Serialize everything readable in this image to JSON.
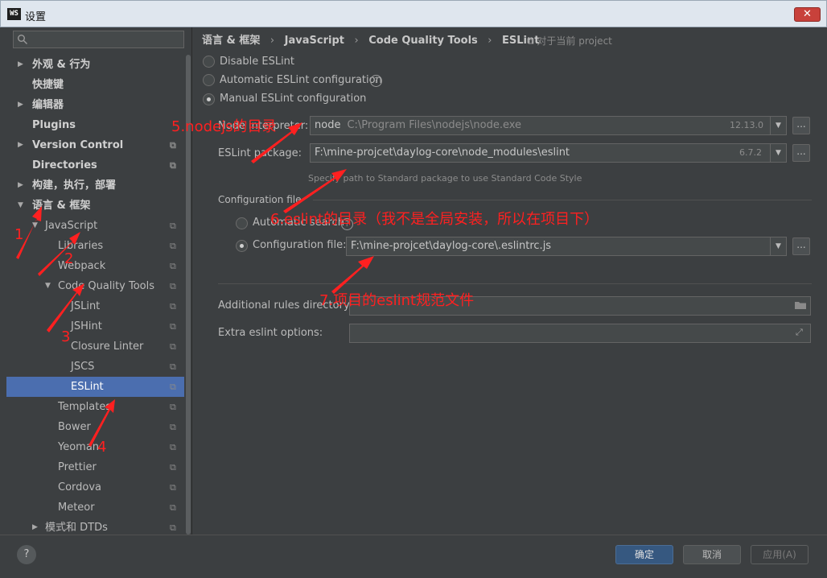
{
  "window": {
    "title": "设置",
    "app_icon_text": "WS",
    "close_label": "✕"
  },
  "sidebar": {
    "search_placeholder": "",
    "items": [
      {
        "label": "外观 & 行为",
        "bold": true,
        "arrow": "right",
        "indent": 0
      },
      {
        "label": "快捷键",
        "bold": true,
        "arrow": "",
        "indent": 0
      },
      {
        "label": "编辑器",
        "bold": true,
        "arrow": "right",
        "indent": 0
      },
      {
        "label": "Plugins",
        "bold": true,
        "arrow": "",
        "indent": 0
      },
      {
        "label": "Version Control",
        "bold": true,
        "arrow": "right",
        "indent": 0,
        "copy": true
      },
      {
        "label": "Directories",
        "bold": true,
        "arrow": "",
        "indent": 0,
        "copy": true
      },
      {
        "label": "构建，执行，部署",
        "bold": true,
        "arrow": "right",
        "indent": 0
      },
      {
        "label": "语言 & 框架",
        "bold": true,
        "arrow": "down",
        "indent": 0
      },
      {
        "label": "JavaScript",
        "bold": false,
        "arrow": "down",
        "indent": 1,
        "copy": true
      },
      {
        "label": "Libraries",
        "bold": false,
        "arrow": "",
        "indent": 2,
        "copy": true
      },
      {
        "label": "Webpack",
        "bold": false,
        "arrow": "",
        "indent": 2,
        "copy": true
      },
      {
        "label": "Code Quality Tools",
        "bold": false,
        "arrow": "down",
        "indent": 2,
        "copy": true
      },
      {
        "label": "JSLint",
        "bold": false,
        "arrow": "",
        "indent": 3,
        "copy": true
      },
      {
        "label": "JSHint",
        "bold": false,
        "arrow": "",
        "indent": 3,
        "copy": true
      },
      {
        "label": "Closure Linter",
        "bold": false,
        "arrow": "",
        "indent": 3,
        "copy": true
      },
      {
        "label": "JSCS",
        "bold": false,
        "arrow": "",
        "indent": 3,
        "copy": true
      },
      {
        "label": "ESLint",
        "bold": false,
        "arrow": "",
        "indent": 3,
        "copy": true,
        "selected": true
      },
      {
        "label": "Templates",
        "bold": false,
        "arrow": "",
        "indent": 2,
        "copy": true
      },
      {
        "label": "Bower",
        "bold": false,
        "arrow": "",
        "indent": 2,
        "copy": true
      },
      {
        "label": "Yeoman",
        "bold": false,
        "arrow": "",
        "indent": 2,
        "copy": true
      },
      {
        "label": "Prettier",
        "bold": false,
        "arrow": "",
        "indent": 2,
        "copy": true
      },
      {
        "label": "Cordova",
        "bold": false,
        "arrow": "",
        "indent": 2,
        "copy": true
      },
      {
        "label": "Meteor",
        "bold": false,
        "arrow": "",
        "indent": 2,
        "copy": true
      },
      {
        "label": "模式和 DTDs",
        "bold": false,
        "arrow": "right",
        "indent": 1,
        "copy": true
      }
    ]
  },
  "breadcrumb": [
    "语言 & 框架",
    "JavaScript",
    "Code Quality Tools",
    "ESLint"
  ],
  "breadcrumb_separator": "›",
  "scope_label": "对于当前 project",
  "options": {
    "disable": "Disable ESLint",
    "automatic": "Automatic ESLint configuration",
    "manual": "Manual ESLint configuration",
    "selected": "manual"
  },
  "node_interpreter": {
    "label": "Node interpreter:",
    "value": "node",
    "path": "C:\\Program Files\\nodejs\\node.exe",
    "version": "12.13.0"
  },
  "eslint_package": {
    "label": "ESLint package:",
    "value": "F:\\mine-projcet\\daylog-core\\node_modules\\eslint",
    "version": "6.7.2",
    "hint": "Specify path to Standard package to use Standard Code Style"
  },
  "configuration": {
    "section_title": "Configuration file",
    "automatic_label": "Automatic search",
    "file_label": "Configuration file:",
    "file_value": "F:\\mine-projcet\\daylog-core\\.eslintrc.js",
    "selected": "file"
  },
  "additional_rules": {
    "label": "Additional rules directory:",
    "value": ""
  },
  "extra_options": {
    "label": "Extra eslint options:",
    "value": ""
  },
  "buttons": {
    "ok": "确定",
    "cancel": "取消",
    "apply": "应用(A)",
    "help": "?",
    "browse": "..."
  },
  "annotations": [
    "1",
    "2",
    "3",
    "4",
    "5.nodejs的目录",
    "6.eslint的目录（我不是全局安装，所以在项目下）",
    "7.项目的eslint规范文件"
  ],
  "colors": {
    "background": "#3c3f41",
    "selection": "#4b6eaf",
    "primary_button": "#365880",
    "annotation": "#ff2020"
  }
}
